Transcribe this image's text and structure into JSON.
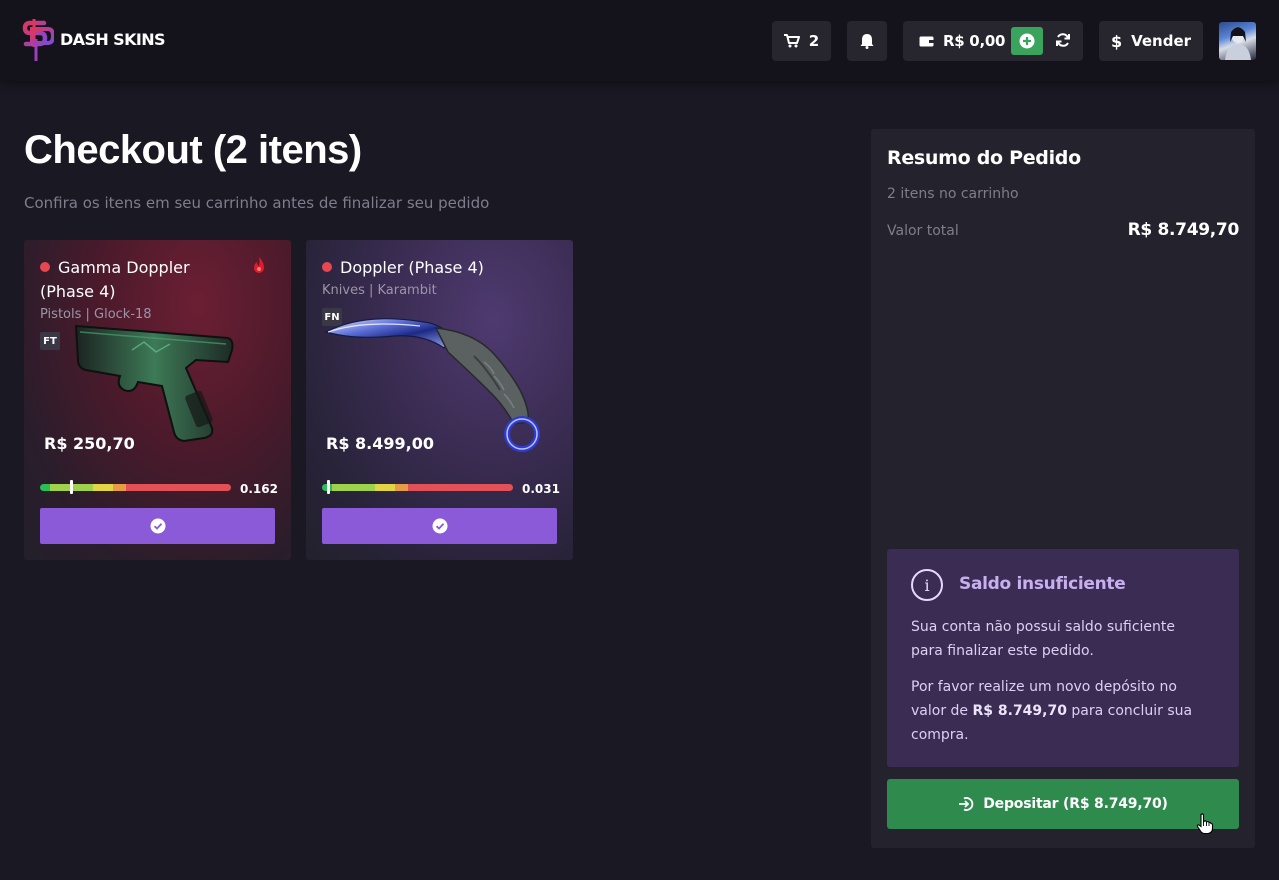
{
  "header": {
    "logo_text": "DASH SKINS",
    "cart_count": "2",
    "wallet_balance": "R$ 0,00",
    "sell_label": "Vender",
    "sell_symbol": "$"
  },
  "page": {
    "title": "Checkout (2 itens)",
    "subtitle": "Confira os itens em seu carrinho antes de finalizar seu pedido"
  },
  "items": [
    {
      "name": "Gamma Doppler (Phase 4)",
      "category": "Pistols | Glock-18",
      "wear": "FT",
      "price": "R$ 250,70",
      "float": "0.162",
      "float_value": 0.162,
      "status_color": "#e8474e"
    },
    {
      "name": "Doppler (Phase 4)",
      "category": "Knives | Karambit",
      "wear": "FN",
      "price": "R$ 8.499,00",
      "float": "0.031",
      "float_value": 0.031,
      "status_color": "#e8474e"
    }
  ],
  "summary": {
    "title": "Resumo do Pedido",
    "items_count": "2 itens no carrinho",
    "total_label": "Valor total",
    "total_value": "R$ 8.749,70",
    "warning": {
      "title": "Saldo insuficiente",
      "text1": "Sua conta não possui saldo suficiente para finalizar este pedido.",
      "text2_prefix": "Por favor realize um novo depósito no valor de ",
      "text2_amount": "R$ 8.749,70",
      "text2_suffix": " para concluir sua compra."
    },
    "deposit_label": "Depositar (R$ 8.749,70)"
  },
  "colors": {
    "accent_purple": "#8b5ad8",
    "deposit_green": "#2f8a4e",
    "add_green": "#3aa45c",
    "warning_bg": "#3b2c54"
  },
  "icons": [
    "cart-icon",
    "bell-icon",
    "wallet-icon",
    "plus-circle-icon",
    "refresh-icon",
    "dollar-icon",
    "fire-icon",
    "check-circle-icon",
    "info-icon",
    "sign-in-icon"
  ]
}
